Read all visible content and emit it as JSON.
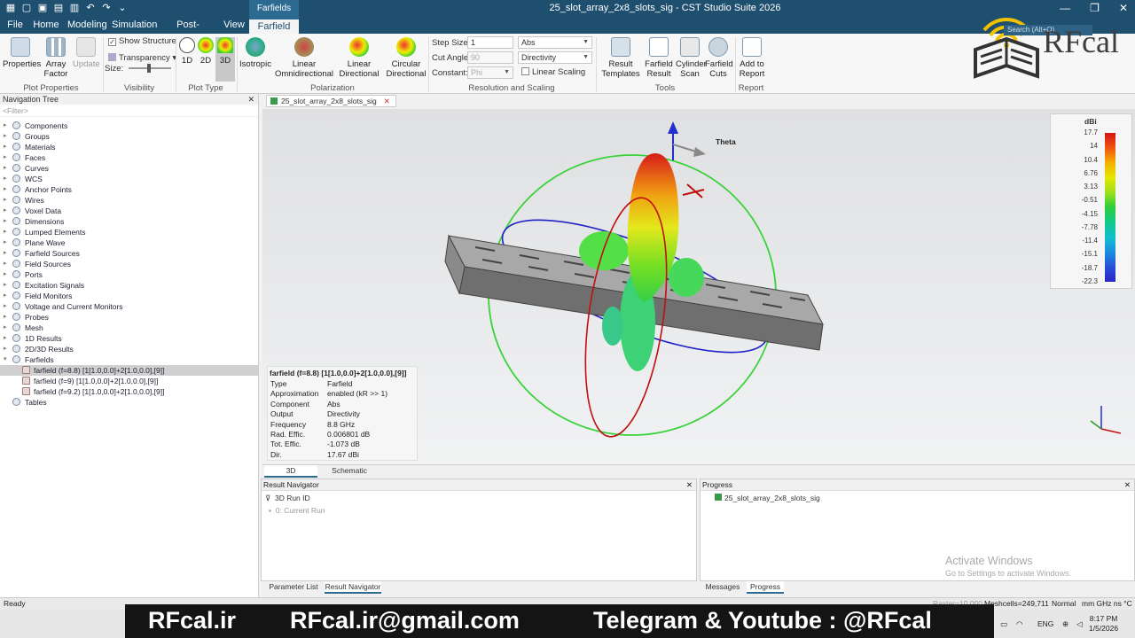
{
  "titlebar": {
    "title": "25_slot_array_2x8_slots_sig - CST Studio Suite 2026",
    "context_tab": "Farfields",
    "search_placeholder": "Search (Alt+Q)"
  },
  "menubar": {
    "tabs": [
      "File",
      "Home",
      "Modeling",
      "Simulation",
      "Post-Processing",
      "View",
      "Farfield Plot"
    ],
    "active": "Farfield Plot"
  },
  "ribbon": {
    "plot_properties": {
      "label": "Plot Properties",
      "properties": "Properties",
      "array_factor": "Array\nFactor",
      "update": "Update"
    },
    "visibility": {
      "label": "Visibility",
      "show_structure": "Show Structure",
      "transparency": "Transparency",
      "size": "Size:"
    },
    "plot_type": {
      "label": "Plot Type",
      "d1": "1D",
      "d2": "2D",
      "d3": "3D"
    },
    "polarization": {
      "label": "Polarization",
      "isotropic": "Isotropic",
      "linear_omni": "Linear\nOmnidirectional",
      "linear_dir": "Linear\nDirectional",
      "circular_dir": "Circular\nDirectional"
    },
    "resolution": {
      "label": "Resolution and Scaling",
      "step_size_label": "Step Size:",
      "step_size": "1",
      "cut_angle_label": "Cut Angle:",
      "cut_angle": "90",
      "constant_label": "Constant:",
      "constant": "Phi",
      "abs": "Abs",
      "directivity": "Directivity",
      "linear_scaling": "Linear Scaling"
    },
    "tools": {
      "label": "Tools",
      "result_templates": "Result\nTemplates",
      "farfield_result": "Farfield\nResult",
      "cylinder_scan": "Cylinder\nScan",
      "farfield_cuts": "Farfield\nCuts"
    },
    "report": {
      "label": "Report",
      "add_to_report": "Add to\nReport"
    }
  },
  "navtree": {
    "title": "Navigation Tree",
    "filter": "<Filter>",
    "items": [
      {
        "label": "Components"
      },
      {
        "label": "Groups"
      },
      {
        "label": "Materials"
      },
      {
        "label": "Faces"
      },
      {
        "label": "Curves"
      },
      {
        "label": "WCS"
      },
      {
        "label": "Anchor Points"
      },
      {
        "label": "Wires"
      },
      {
        "label": "Voxel Data"
      },
      {
        "label": "Dimensions"
      },
      {
        "label": "Lumped Elements"
      },
      {
        "label": "Plane Wave"
      },
      {
        "label": "Farfield Sources"
      },
      {
        "label": "Field Sources"
      },
      {
        "label": "Ports"
      },
      {
        "label": "Excitation Signals"
      },
      {
        "label": "Field Monitors"
      },
      {
        "label": "Voltage and Current Monitors"
      },
      {
        "label": "Probes"
      },
      {
        "label": "Mesh"
      },
      {
        "label": "1D Results"
      },
      {
        "label": "2D/3D Results"
      },
      {
        "label": "Farfields"
      }
    ],
    "farfield_children": [
      "farfield (f=8.8) [1[1.0,0.0]+2[1.0,0.0],[9]]",
      "farfield (f=9) [1[1.0,0.0]+2[1.0,0.0],[9]]",
      "farfield (f=9.2) [1[1.0,0.0]+2[1.0,0.0],[9]]"
    ],
    "last": "Tables"
  },
  "view": {
    "doc_tab": "25_slot_array_2x8_slots_sig",
    "theta_label": "Theta",
    "tabs": [
      "3D",
      "Schematic"
    ],
    "legend": {
      "unit": "dBi",
      "levels": [
        "17.7",
        "14",
        "10.4",
        "6.76",
        "3.13",
        "-0.51",
        "-4.15",
        "-7.78",
        "-11.4",
        "-15.1",
        "-18.7",
        "-22.3"
      ]
    },
    "info": {
      "title": "farfield (f=8.8) [1[1.0,0.0]+2[1.0,0.0],[9]]",
      "rows": [
        {
          "k": "Type",
          "v": "Farfield"
        },
        {
          "k": "Approximation",
          "v": "enabled (kR >> 1)"
        },
        {
          "k": "Component",
          "v": "Abs"
        },
        {
          "k": "Output",
          "v": "Directivity"
        },
        {
          "k": "Frequency",
          "v": "8.8 GHz"
        },
        {
          "k": "Rad. Effic.",
          "v": "0.006801 dB"
        },
        {
          "k": "Tot. Effic.",
          "v": "-1.073 dB"
        },
        {
          "k": "Dir.",
          "v": "17.67 dBi"
        }
      ]
    }
  },
  "result_navigator": {
    "title": "Result Navigator",
    "col": "3D Run ID",
    "row": "0: Current Run"
  },
  "progress": {
    "title": "Progress",
    "item": "25_slot_array_2x8_slots_sig"
  },
  "bottom_tabs": {
    "left": [
      "Parameter List",
      "Result Navigator"
    ],
    "right": [
      "Messages",
      "Progress"
    ]
  },
  "activate": {
    "line1": "Activate Windows",
    "line2": "Go to Settings to activate Windows."
  },
  "statusbar": {
    "ready": "Ready",
    "raster": "Raster=10.000",
    "meshcells": "Meshcells=249,711",
    "normal": "Normal",
    "units": "mm  GHz  ns  °C"
  },
  "taskbar": {
    "lang": "ENG",
    "time": "8:17 PM",
    "date": "1/5/2026"
  },
  "banner": {
    "site": "RFcal.ir",
    "email": "RFcal.ir@gmail.com",
    "social": "Telegram & Youtube : @RFcal"
  },
  "logo": {
    "text": "RFcal"
  },
  "colors": {
    "ribbon_blue": "#1e4f6e",
    "accent": "#2c6a92",
    "banner_bg": "#141414"
  }
}
